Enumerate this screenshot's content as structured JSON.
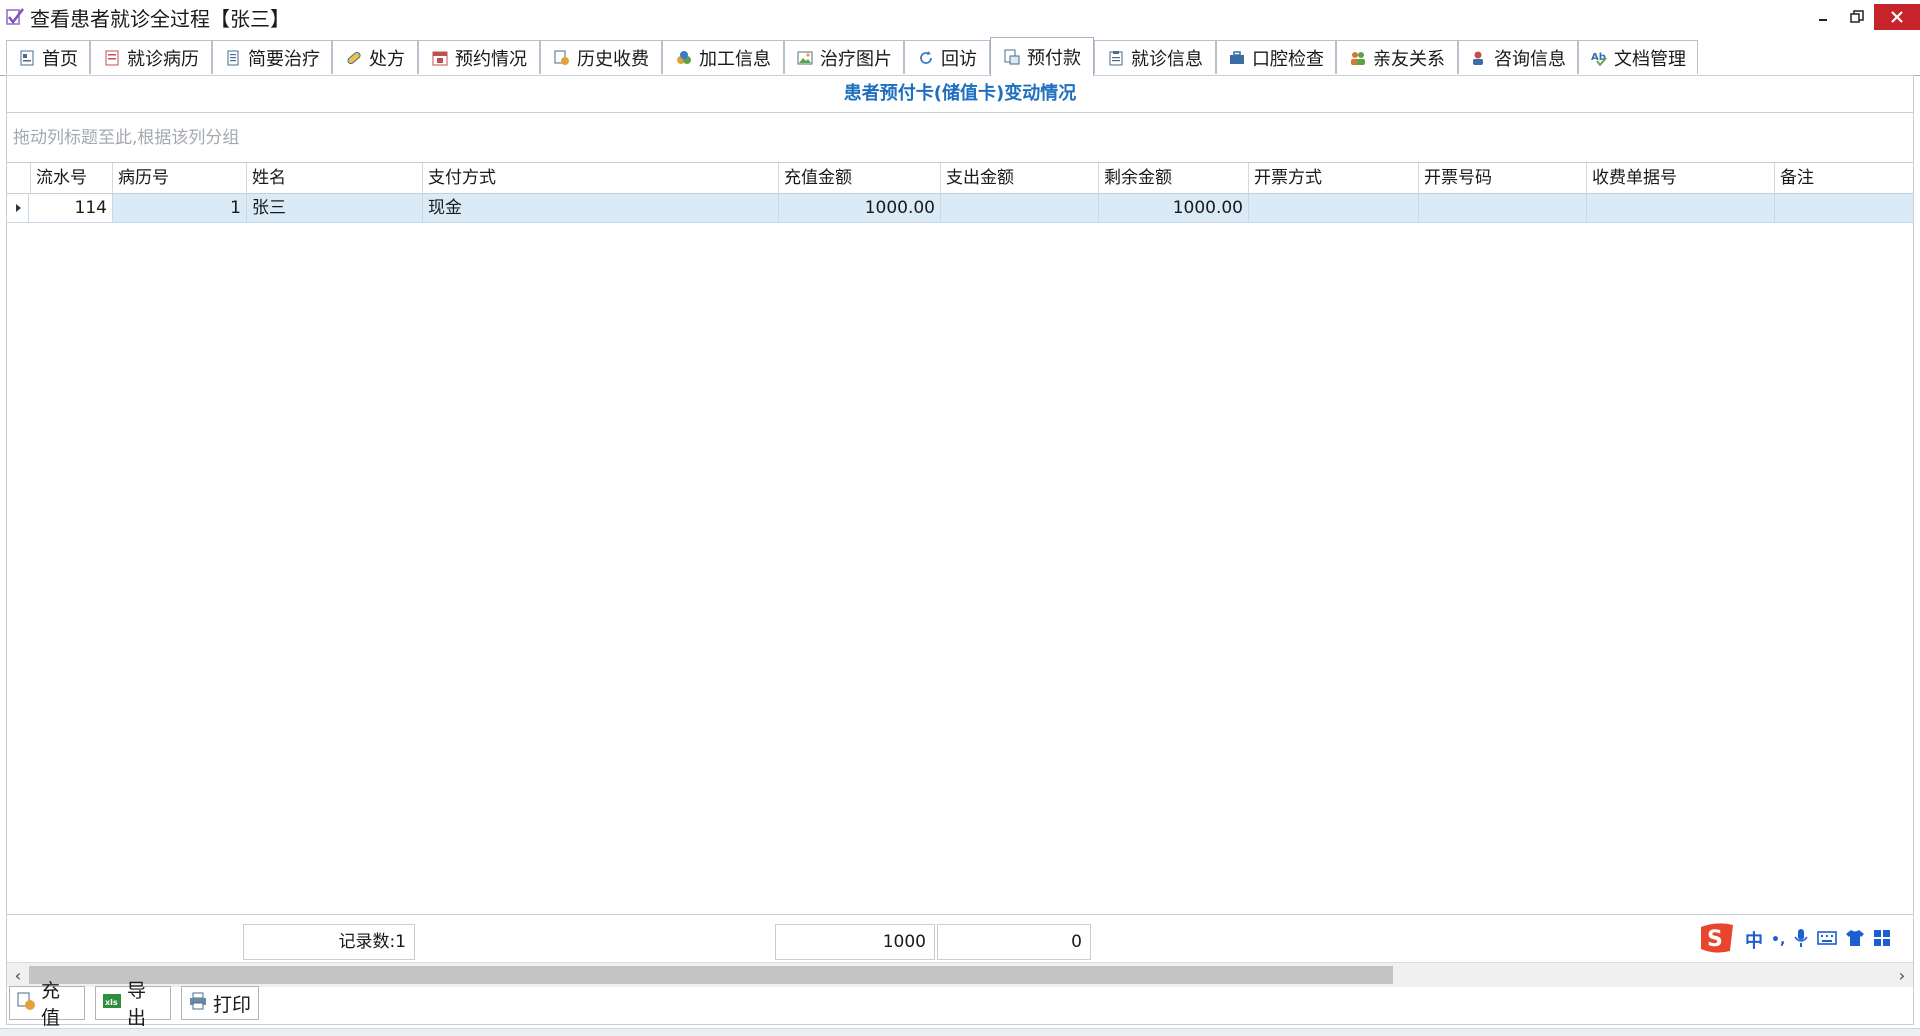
{
  "window": {
    "title": "查看患者就诊全过程【张三】"
  },
  "tabs": [
    {
      "label": "首页",
      "icon": "home-icon"
    },
    {
      "label": "就诊病历",
      "icon": "medical-record-icon"
    },
    {
      "label": "简要治疗",
      "icon": "document-icon"
    },
    {
      "label": "处方",
      "icon": "pill-icon"
    },
    {
      "label": "预约情况",
      "icon": "calendar-icon"
    },
    {
      "label": "历史收费",
      "icon": "billing-history-icon"
    },
    {
      "label": "加工信息",
      "icon": "processing-icon"
    },
    {
      "label": "治疗图片",
      "icon": "image-icon"
    },
    {
      "label": "回访",
      "icon": "refresh-icon"
    },
    {
      "label": "预付款",
      "icon": "prepayment-icon",
      "active": true
    },
    {
      "label": "就诊信息",
      "icon": "clipboard-icon"
    },
    {
      "label": "口腔检查",
      "icon": "briefcase-icon"
    },
    {
      "label": "亲友关系",
      "icon": "people-icon"
    },
    {
      "label": "咨询信息",
      "icon": "consult-icon"
    },
    {
      "label": "文档管理",
      "icon": "spellcheck-icon"
    }
  ],
  "panel": {
    "title": "患者预付卡(储值卡)变动情况",
    "group_hint": "拖动列标题至此,根据该列分组"
  },
  "grid": {
    "columns": [
      "流水号",
      "病历号",
      "姓名",
      "支付方式",
      "充值金额",
      "支出金额",
      "剩余金额",
      "开票方式",
      "开票号码",
      "收费单据号",
      "备注"
    ],
    "rows": [
      [
        "114",
        "1",
        "张三",
        "现金",
        "1000.00",
        "",
        "1000.00",
        "",
        "",
        "",
        ""
      ]
    ]
  },
  "footer": {
    "record_count": "记录数:1",
    "recharge_total": "1000",
    "expense_total": "0"
  },
  "toolbar": {
    "recharge_label": "充值",
    "export_label": "导出",
    "print_label": "打印"
  },
  "ime": {
    "mode_label": "中",
    "punct_label": "•,"
  },
  "colors": {
    "accent": "#1e6fc0",
    "row_selected": "#dbeaf7",
    "close_button": "#c7232a",
    "ime_logo": "#e8452c"
  }
}
